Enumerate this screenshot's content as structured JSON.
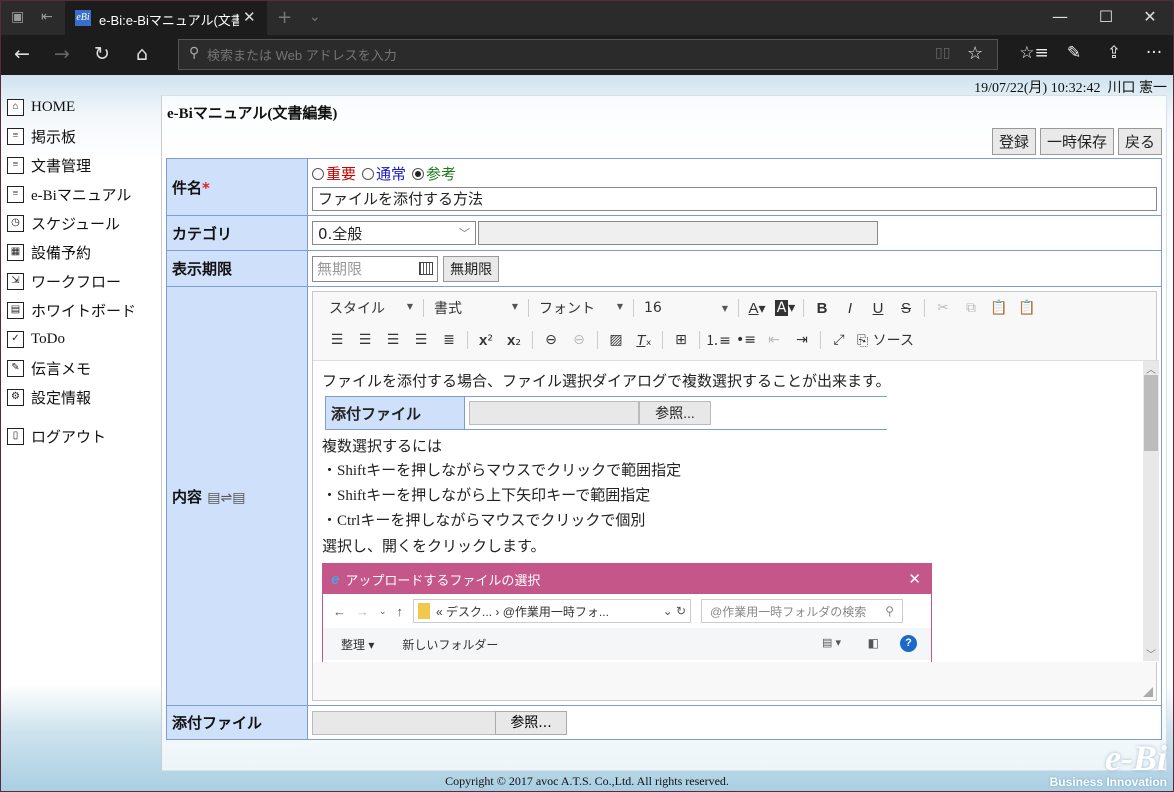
{
  "browser": {
    "tab_title": "e-Bi:e-Biマニュアル(文書編",
    "address_placeholder": "検索または Web アドレスを入力",
    "icons": {
      "tab_manager": "▣",
      "set_aside": "⇤",
      "new_tab": "+",
      "tab_list": "⌄",
      "minimize": "—",
      "maximize": "☐",
      "close": "✕",
      "back": "←",
      "forward": "→",
      "refresh": "↻",
      "home": "⌂",
      "search": "⚲",
      "reading_view": "📖",
      "favorite": "☆",
      "favorites_list": "☆≡",
      "notes": "✎",
      "share": "⇪",
      "more": "···"
    }
  },
  "header": {
    "datetime": "19/07/22(月) 10:32:42",
    "user": "川口 憲一"
  },
  "sidebar": {
    "items": [
      {
        "label": "HOME",
        "icon": "home-icon",
        "glyph": "⌂"
      },
      {
        "label": "掲示板",
        "icon": "board-icon",
        "glyph": "≡"
      },
      {
        "label": "文書管理",
        "icon": "document-icon",
        "glyph": "≡"
      },
      {
        "label": "e-Biマニュアル",
        "icon": "manual-icon",
        "glyph": "≡"
      },
      {
        "label": "スケジュール",
        "icon": "clock-icon",
        "glyph": "◷"
      },
      {
        "label": "設備予約",
        "icon": "facility-icon",
        "glyph": "▦"
      },
      {
        "label": "ワークフロー",
        "icon": "workflow-icon",
        "glyph": "⇲"
      },
      {
        "label": "ホワイトボード",
        "icon": "whiteboard-icon",
        "glyph": "▤"
      },
      {
        "label": "ToDo",
        "icon": "todo-icon",
        "glyph": "✓"
      },
      {
        "label": "伝言メモ",
        "icon": "memo-icon",
        "glyph": "✎"
      },
      {
        "label": "設定情報",
        "icon": "gear-icon",
        "glyph": "⚙"
      },
      {
        "label": "ログアウト",
        "icon": "logout-icon",
        "glyph": "▯"
      }
    ]
  },
  "main": {
    "title": "e-Biマニュアル(文書編集)",
    "buttons": {
      "register": "登録",
      "temp_save": "一時保存",
      "back": "戻る"
    },
    "form": {
      "subject_label": "件名",
      "required_mark": "*",
      "priority_options": [
        {
          "label": "重要",
          "color": "#cc0000",
          "selected": false
        },
        {
          "label": "通常",
          "color": "#1a1acc",
          "selected": false
        },
        {
          "label": "参考",
          "color": "#1a7a1a",
          "selected": true
        }
      ],
      "subject_value": "ファイルを添付する方法",
      "category_label": "カテゴリ",
      "category_value": "0.全般",
      "display_period_label": "表示期限",
      "display_period_placeholder": "無期限",
      "no_limit_button": "無期限",
      "content_label": "内容",
      "attachment_label": "添付ファイル",
      "browse_button": "参照..."
    },
    "editor": {
      "toolbar_row1": {
        "combos": [
          "スタイル",
          "書式",
          "フォント",
          "16"
        ],
        "text_color": "A",
        "bg_color": "A",
        "bold": "B",
        "italic": "I",
        "underline": "U",
        "strike": "S"
      },
      "source_label": "ソース",
      "content": {
        "intro": "ファイルを添付する場合、ファイル選択ダイアログで複数選択することが出来ます。",
        "inner_attach_label": "添付ファイル",
        "inner_browse": "参照...",
        "lines": [
          "複数選択するには",
          "・Shiftキーを押しながらマウスでクリックで範囲指定",
          "・Shiftキーを押しながら上下矢印キーで範囲指定",
          "・Ctrlキーを押しながらマウスでクリックで個別",
          "選択し、開くをクリックします。"
        ],
        "dialog": {
          "title": "アップロードするファイルの選択",
          "path": "« デスク... ›  @作業用一時フォ...",
          "search_placeholder": "@作業用一時フォルダの検索",
          "organize": "整理 ▾",
          "new_folder": "新しいフォルダー"
        }
      }
    }
  },
  "footer": {
    "copyright": "Copyright © 2017 avoc A.T.S. Co.,Ltd. All rights reserved.",
    "logo": "e-Bi",
    "logo_sub": "Business Innovation"
  }
}
